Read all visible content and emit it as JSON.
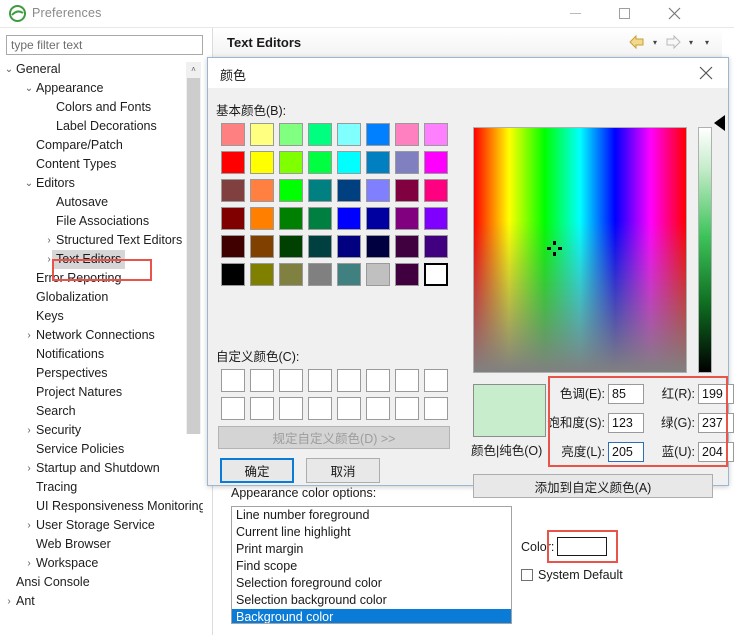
{
  "window": {
    "title": "Preferences",
    "app_icon": "eclipse-icon",
    "minimize_label": "–",
    "maximize_label": "□",
    "close_label": "✕"
  },
  "filter": {
    "placeholder": "type filter text",
    "value": ""
  },
  "tree": {
    "items": [
      {
        "label": "General",
        "indent": 0,
        "twisty": "⌄",
        "selected": false
      },
      {
        "label": "Appearance",
        "indent": 1,
        "twisty": "⌄",
        "selected": false
      },
      {
        "label": "Colors and Fonts",
        "indent": 2,
        "twisty": "",
        "selected": false
      },
      {
        "label": "Label Decorations",
        "indent": 2,
        "twisty": "",
        "selected": false
      },
      {
        "label": "Compare/Patch",
        "indent": 1,
        "twisty": "",
        "selected": false
      },
      {
        "label": "Content Types",
        "indent": 1,
        "twisty": "",
        "selected": false
      },
      {
        "label": "Editors",
        "indent": 1,
        "twisty": "⌄",
        "selected": false
      },
      {
        "label": "Autosave",
        "indent": 2,
        "twisty": "",
        "selected": false
      },
      {
        "label": "File Associations",
        "indent": 2,
        "twisty": "",
        "selected": false
      },
      {
        "label": "Structured Text Editors",
        "indent": 2,
        "twisty": "›",
        "selected": false
      },
      {
        "label": "Text Editors",
        "indent": 2,
        "twisty": "›",
        "selected": true
      },
      {
        "label": "Error Reporting",
        "indent": 1,
        "twisty": "",
        "selected": false
      },
      {
        "label": "Globalization",
        "indent": 1,
        "twisty": "",
        "selected": false
      },
      {
        "label": "Keys",
        "indent": 1,
        "twisty": "",
        "selected": false
      },
      {
        "label": "Network Connections",
        "indent": 1,
        "twisty": "›",
        "selected": false
      },
      {
        "label": "Notifications",
        "indent": 1,
        "twisty": "",
        "selected": false
      },
      {
        "label": "Perspectives",
        "indent": 1,
        "twisty": "",
        "selected": false
      },
      {
        "label": "Project Natures",
        "indent": 1,
        "twisty": "",
        "selected": false
      },
      {
        "label": "Search",
        "indent": 1,
        "twisty": "",
        "selected": false
      },
      {
        "label": "Security",
        "indent": 1,
        "twisty": "›",
        "selected": false
      },
      {
        "label": "Service Policies",
        "indent": 1,
        "twisty": "",
        "selected": false
      },
      {
        "label": "Startup and Shutdown",
        "indent": 1,
        "twisty": "›",
        "selected": false
      },
      {
        "label": "Tracing",
        "indent": 1,
        "twisty": "",
        "selected": false
      },
      {
        "label": "UI Responsiveness Monitoring",
        "indent": 1,
        "twisty": "",
        "selected": false
      },
      {
        "label": "User Storage Service",
        "indent": 1,
        "twisty": "›",
        "selected": false
      },
      {
        "label": "Web Browser",
        "indent": 1,
        "twisty": "",
        "selected": false
      },
      {
        "label": "Workspace",
        "indent": 1,
        "twisty": "›",
        "selected": false
      },
      {
        "label": "Ansi Console",
        "indent": 0,
        "twisty": "",
        "selected": false
      },
      {
        "label": "Ant",
        "indent": 0,
        "twisty": "›",
        "selected": false
      }
    ],
    "scroll_up_glyph": "˄"
  },
  "page": {
    "title": "Text Editors",
    "nav": {
      "back_icon": "back-arrow-icon",
      "back_caret": "▾",
      "forward_icon": "forward-arrow-icon",
      "forward_caret": "▾",
      "menu_caret": "▾"
    }
  },
  "appearance": {
    "section_label": "Appearance color options:",
    "options": [
      {
        "label": "Line number foreground",
        "selected": false
      },
      {
        "label": "Current line highlight",
        "selected": false
      },
      {
        "label": "Print margin",
        "selected": false
      },
      {
        "label": "Find scope",
        "selected": false
      },
      {
        "label": "Selection foreground color",
        "selected": false
      },
      {
        "label": "Selection background color",
        "selected": false
      },
      {
        "label": "Background color",
        "selected": true
      }
    ],
    "color_label": "Color:",
    "color_value": "#ffffff",
    "system_default_label": "System Default",
    "system_default_checked": false
  },
  "color_dialog": {
    "title": "颜色",
    "close_label": "✕",
    "basic_colors_label": "基本颜色(B):",
    "custom_colors_label": "自定义颜色(C):",
    "define_custom_label": "规定自定义颜色(D)  >>",
    "ok_label": "确定",
    "cancel_label": "取消",
    "add_to_custom_label": "添加到自定义颜色(A)",
    "preview_label": "颜色|纯色(O)",
    "preview_color": "#c7edcc",
    "basic_colors": [
      "#ff8080",
      "#ffff80",
      "#80ff80",
      "#00ff80",
      "#80ffff",
      "#0080ff",
      "#ff80c0",
      "#ff80ff",
      "#ff0000",
      "#ffff00",
      "#80ff00",
      "#00ff40",
      "#00ffff",
      "#0080c0",
      "#8080c0",
      "#ff00ff",
      "#804040",
      "#ff8040",
      "#00ff00",
      "#008080",
      "#004080",
      "#8080ff",
      "#800040",
      "#ff0080",
      "#800000",
      "#ff8000",
      "#008000",
      "#008040",
      "#0000ff",
      "#0000a0",
      "#800080",
      "#8000ff",
      "#400000",
      "#804000",
      "#004000",
      "#004040",
      "#000080",
      "#000040",
      "#400040",
      "#400080",
      "#000000",
      "#808000",
      "#808040",
      "#808080",
      "#408080",
      "#c0c0c0",
      "#400040",
      "#ffffff"
    ],
    "basic_selected_index": 47,
    "custom_colors": [
      "#ffffff",
      "#ffffff",
      "#ffffff",
      "#ffffff",
      "#ffffff",
      "#ffffff",
      "#ffffff",
      "#ffffff",
      "#ffffff",
      "#ffffff",
      "#ffffff",
      "#ffffff",
      "#ffffff",
      "#ffffff",
      "#ffffff",
      "#ffffff"
    ],
    "fields": [
      {
        "label": "色调(E):",
        "value": "85",
        "name": "hue-field",
        "focused": false
      },
      {
        "label": "饱和度(S):",
        "value": "123",
        "name": "saturation-field",
        "focused": false
      },
      {
        "label": "亮度(L):",
        "value": "205",
        "name": "luminance-field",
        "focused": true
      },
      {
        "label": "红(R):",
        "value": "199",
        "name": "red-field",
        "focused": false
      },
      {
        "label": "绿(G):",
        "value": "237",
        "name": "green-field",
        "focused": false
      },
      {
        "label": "蓝(U):",
        "value": "204",
        "name": "blue-field",
        "focused": false
      }
    ]
  },
  "highlight_color": "#e8534a"
}
